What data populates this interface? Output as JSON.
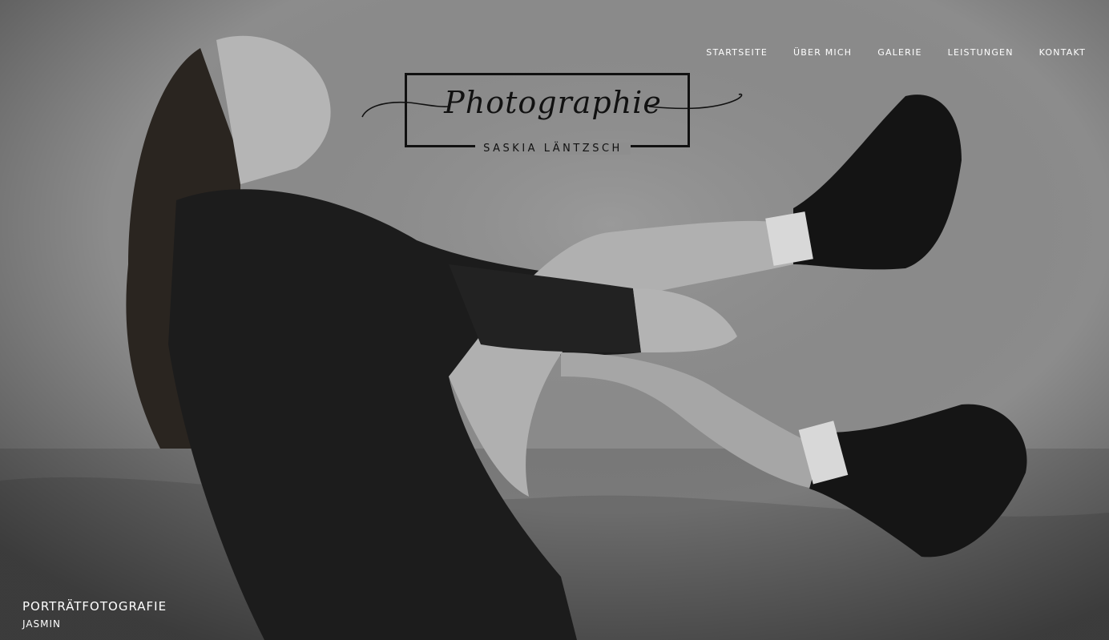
{
  "nav": {
    "items": [
      {
        "label": "STARTSEITE"
      },
      {
        "label": "ÜBER MICH"
      },
      {
        "label": "GALERIE"
      },
      {
        "label": "LEISTUNGEN"
      },
      {
        "label": "KONTAKT"
      }
    ]
  },
  "logo": {
    "script": "Photographie",
    "name": "SASKIA LÄNTZSCH"
  },
  "caption": {
    "category": "PORTRÄTFOTOGRAFIE",
    "subject": "JASMIN"
  },
  "colors": {
    "nav_text": "#ffffff",
    "logo_ink": "#111111"
  }
}
